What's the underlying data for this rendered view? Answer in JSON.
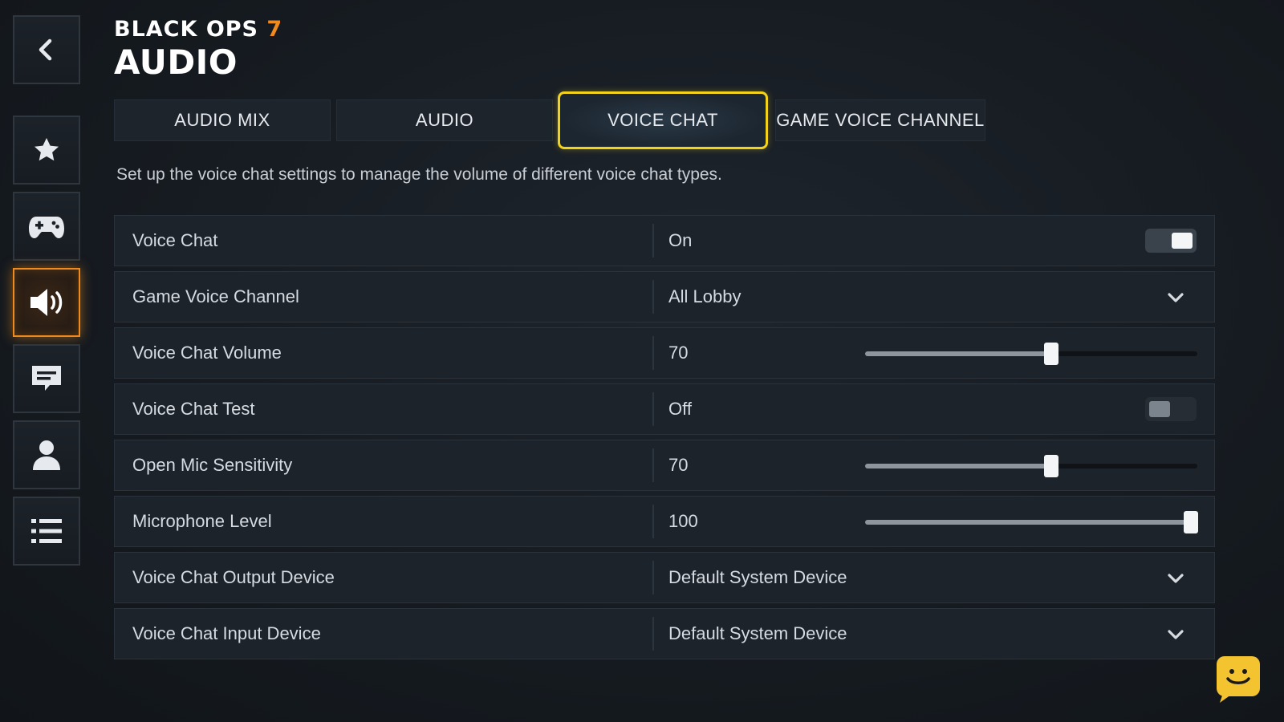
{
  "header": {
    "brand_main": "BLACK OPS ",
    "brand_number": "7",
    "title": "AUDIO"
  },
  "accent_colors": {
    "active_sidebar": "#f08a1c",
    "active_tab": "#f2d21a",
    "brand_seven": "#f08a1c",
    "helper": "#f4c430"
  },
  "sidebar": {
    "items": [
      {
        "icon": "back-arrow-icon"
      },
      {
        "icon": "star-icon"
      },
      {
        "icon": "gamepad-icon"
      },
      {
        "icon": "speaker-icon",
        "active": true
      },
      {
        "icon": "chat-icon"
      },
      {
        "icon": "person-icon"
      },
      {
        "icon": "list-icon"
      }
    ]
  },
  "tabs": [
    {
      "label": "AUDIO MIX",
      "active": false
    },
    {
      "label": "AUDIO",
      "active": false
    },
    {
      "label": "VOICE CHAT",
      "active": true
    },
    {
      "label": "GAME VOICE CHANNEL",
      "active": false
    }
  ],
  "description": "Set up the voice chat settings to manage the volume of different voice chat types.",
  "settings": [
    {
      "label": "Voice Chat",
      "value": "On",
      "control": "toggle",
      "state": true
    },
    {
      "label": "Game Voice Channel",
      "value": "All Lobby",
      "control": "dropdown"
    },
    {
      "label": "Voice Chat Volume",
      "value": "70",
      "control": "slider",
      "level": 0.56
    },
    {
      "label": "Voice Chat Test",
      "value": "Off",
      "control": "toggle",
      "state": false
    },
    {
      "label": "Open Mic Sensitivity",
      "value": "70",
      "control": "slider",
      "level": 0.56
    },
    {
      "label": "Microphone Level",
      "value": "100",
      "control": "slider",
      "level": 0.98
    },
    {
      "label": "Voice Chat Output Device",
      "value": "Default System Device",
      "control": "dropdown"
    },
    {
      "label": "Voice Chat Input Device",
      "value": "Default System Device",
      "control": "dropdown"
    }
  ],
  "helper": {
    "icon": "smiley-chat-icon"
  }
}
